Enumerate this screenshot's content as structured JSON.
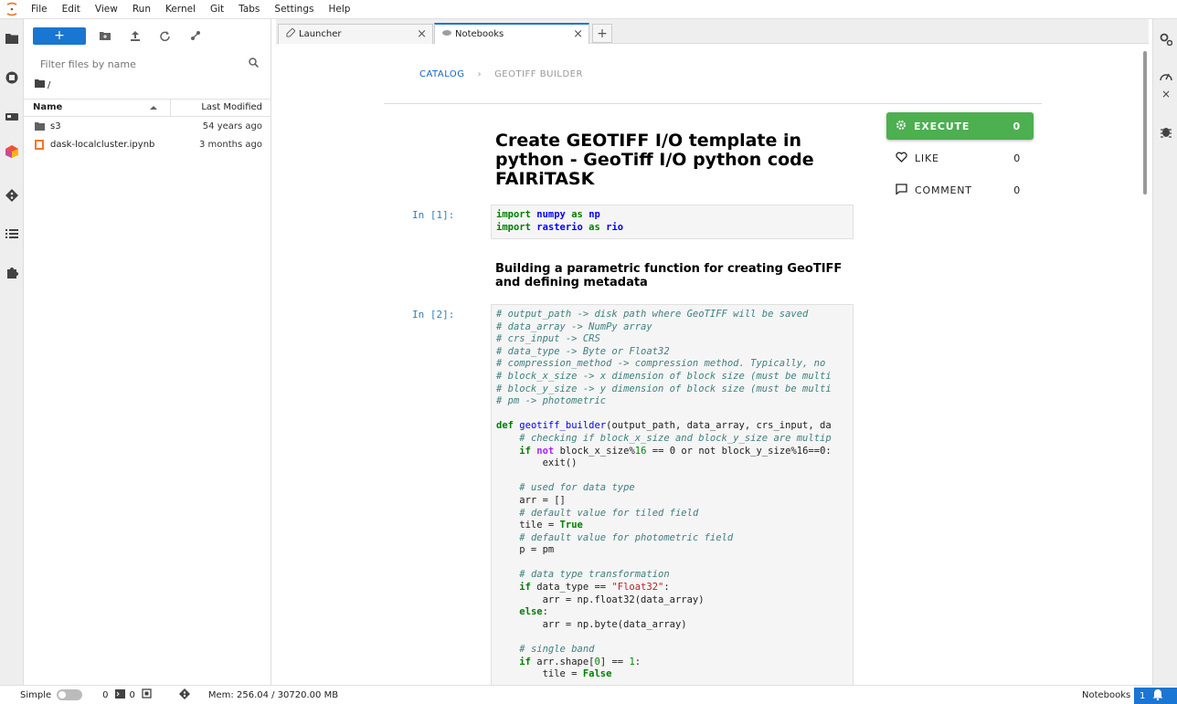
{
  "menu": [
    "File",
    "Edit",
    "View",
    "Run",
    "Kernel",
    "Git",
    "Tabs",
    "Settings",
    "Help"
  ],
  "filebrowser": {
    "new_label": "+",
    "filter_placeholder": "Filter files by name",
    "path": "/",
    "col_name": "Name",
    "col_modified": "Last Modified",
    "files": [
      {
        "name": "s3",
        "modified": "54 years ago",
        "icon": "folder-icon"
      },
      {
        "name": "dask-localcluster.ipynb",
        "modified": "3 months ago",
        "icon": "notebook-icon"
      }
    ]
  },
  "tabs": [
    {
      "label": "Launcher",
      "icon": "launcher-icon"
    },
    {
      "label": "Notebooks",
      "icon": "notebooks-icon"
    }
  ],
  "catalog": {
    "crumb_catalog": "CATALOG",
    "crumb_sep": "›",
    "crumb_current": "GEOTIFF BUILDER",
    "title": "Create GEOTIFF I/O template in python - GeoTiff I/O python code FAIRiTASK",
    "md_heading": "Building a parametric function for creating GeoTIFF and defining metadata",
    "prompt1": "In [1]:",
    "prompt2": "In [2]:",
    "execute": {
      "label": "EXECUTE",
      "count": "0"
    },
    "like": {
      "label": "LIKE",
      "count": "0"
    },
    "comment": {
      "label": "COMMENT",
      "count": "0"
    }
  },
  "status": {
    "mode": "Simple",
    "kernels": "0",
    "terminals": "0",
    "memory": "Mem: 256.04 / 30720.00 MB",
    "right_label": "Notebooks",
    "notif_count": "1"
  },
  "colors": {
    "accent": "#1976d2",
    "execute": "#4caf50"
  }
}
